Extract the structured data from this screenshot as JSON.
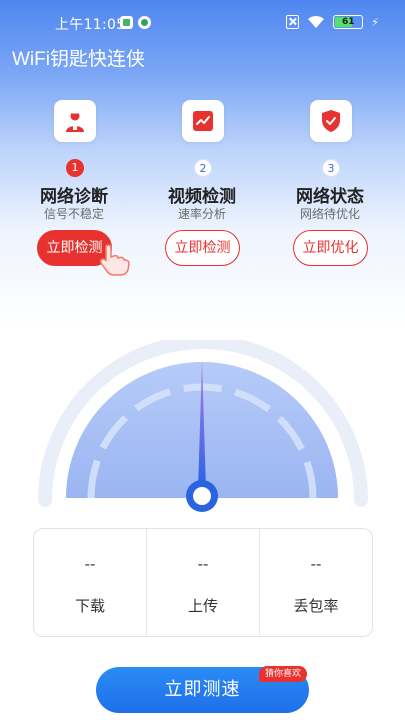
{
  "status_bar": {
    "time": "上午11:05",
    "battery": "61"
  },
  "app": {
    "title": "WiFi钥匙快连侠"
  },
  "features": [
    {
      "step": "1",
      "title": "网络诊断",
      "subtitle": "信号不稳定",
      "button": "立即检测",
      "icon": "doctor-icon"
    },
    {
      "step": "2",
      "title": "视频检测",
      "subtitle": "速率分析",
      "button": "立即检测",
      "icon": "trend-chart-icon"
    },
    {
      "step": "3",
      "title": "网络状态",
      "subtitle": "网络待优化",
      "button": "立即优化",
      "icon": "shield-check-icon"
    }
  ],
  "stats": [
    {
      "value": "--",
      "label": "下载"
    },
    {
      "value": "--",
      "label": "上传"
    },
    {
      "value": "--",
      "label": "丢包率"
    }
  ],
  "speed_button": {
    "label": "立即测速",
    "badge": "猜你喜欢"
  },
  "colors": {
    "accent_red": "#e8322f",
    "primary_blue": "#1f6fe8",
    "gauge_fill": "#a9c2f6"
  }
}
